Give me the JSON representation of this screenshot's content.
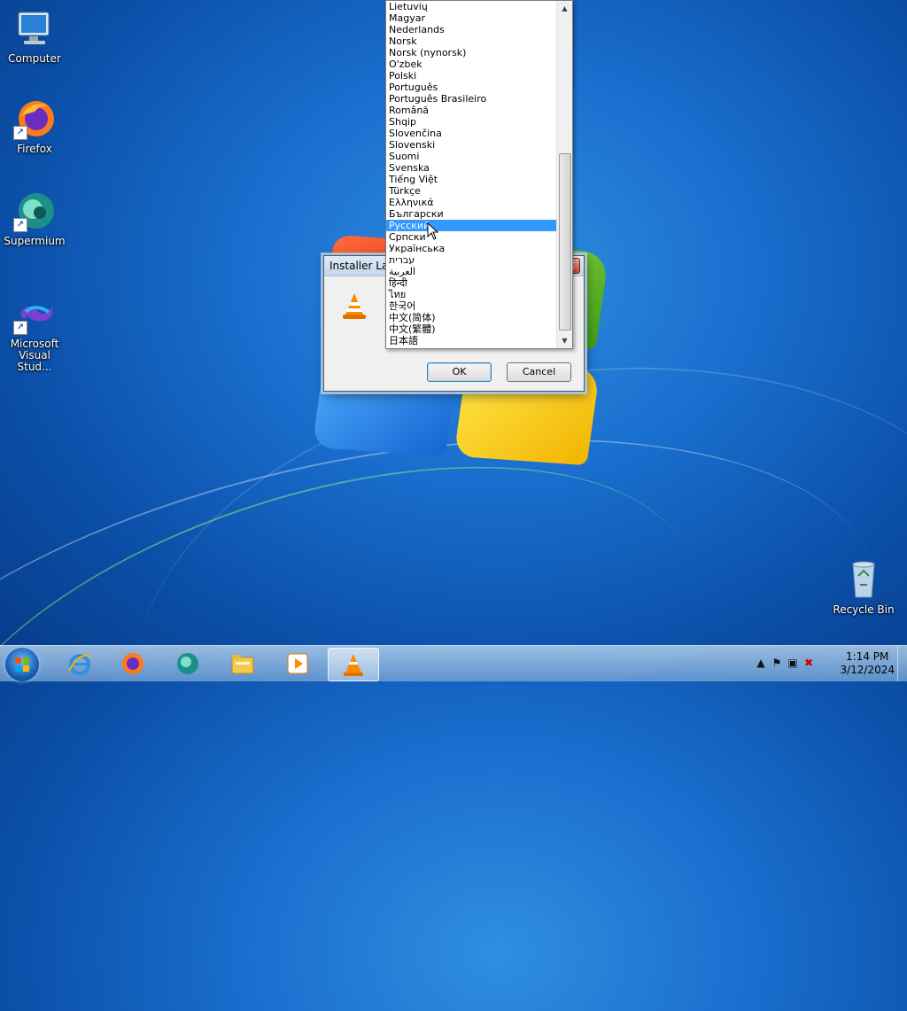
{
  "desktop": {
    "icons": [
      {
        "label": "Computer"
      },
      {
        "label": "Firefox"
      },
      {
        "label": "Supermium"
      },
      {
        "label": "Microsoft Visual Stud..."
      },
      {
        "label": "Recycle Bin"
      }
    ]
  },
  "dialog": {
    "title": "Installer Lan",
    "close_label": "✕",
    "ok_label": "OK",
    "cancel_label": "Cancel"
  },
  "language_list": {
    "selected": "Русский",
    "items": [
      "Lietuvių",
      "Magyar",
      "Nederlands",
      "Norsk",
      "Norsk (nynorsk)",
      "O'zbek",
      "Polski",
      "Português",
      "Português Brasileiro",
      "Română",
      "Shqip",
      "Slovenčina",
      "Slovenski",
      "Suomi",
      "Svenska",
      "Tiếng Việt",
      "Türkçe",
      "Ελληνικά",
      "Български",
      "Русский",
      "Српски",
      "Українська",
      "עברית",
      "العربية",
      "हिन्दी",
      "ไทย",
      "한국어",
      "中文(简体)",
      "中文(繁體)",
      "日本語"
    ]
  },
  "taskbar": {
    "apps": [
      "internet-explorer-icon",
      "firefox-icon",
      "supermium-icon",
      "file-explorer-icon",
      "media-player-icon",
      "vlc-icon"
    ],
    "clock_time": "1:14 PM",
    "clock_date": "3/12/2024"
  },
  "colors": {
    "selection": "#3399ff",
    "desktop": "#1a6fcf"
  }
}
